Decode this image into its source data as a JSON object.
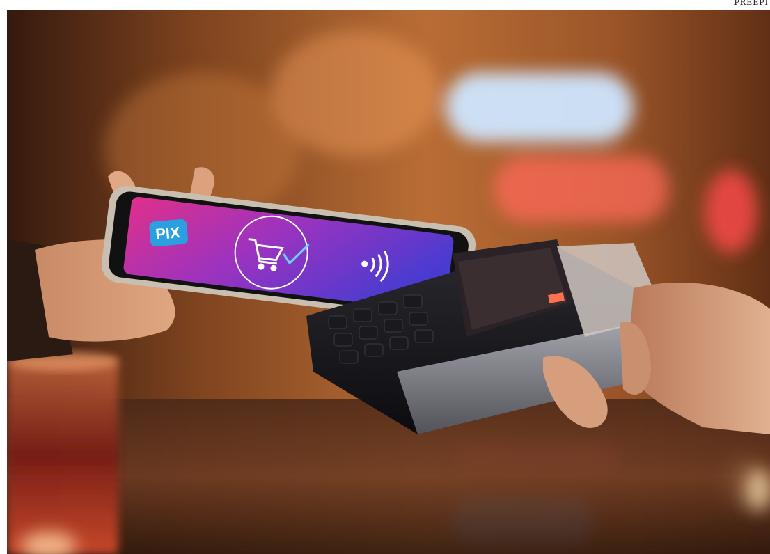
{
  "page": {
    "corner_label": "PREEPI"
  },
  "photo": {
    "phone_screen": {
      "pix_logo_text": "PIX",
      "logo_color": "#2aa0e0",
      "gradient_start": "#e0308a",
      "gradient_end": "#4a3bd0"
    }
  }
}
